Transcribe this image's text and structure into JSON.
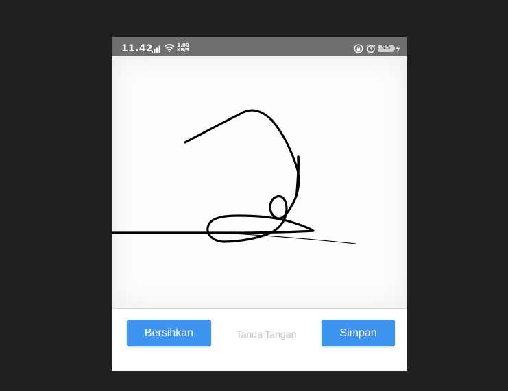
{
  "status_bar": {
    "time": "11.42",
    "net_speed_value": "1.00",
    "net_speed_unit": "KB/S",
    "battery": "95",
    "icons": [
      "signal-icon",
      "wifi-icon",
      "rotation-lock-icon",
      "alarm-icon",
      "charging-icon"
    ]
  },
  "signature_pad": {
    "label": "Tanda Tangan",
    "stroke_color": "#000000"
  },
  "actions": {
    "clear_label": "Bersihkan",
    "save_label": "Simpan"
  },
  "colors": {
    "button": "#3d95f0",
    "status_bar": "#6f6f6f",
    "background": "#202020"
  }
}
